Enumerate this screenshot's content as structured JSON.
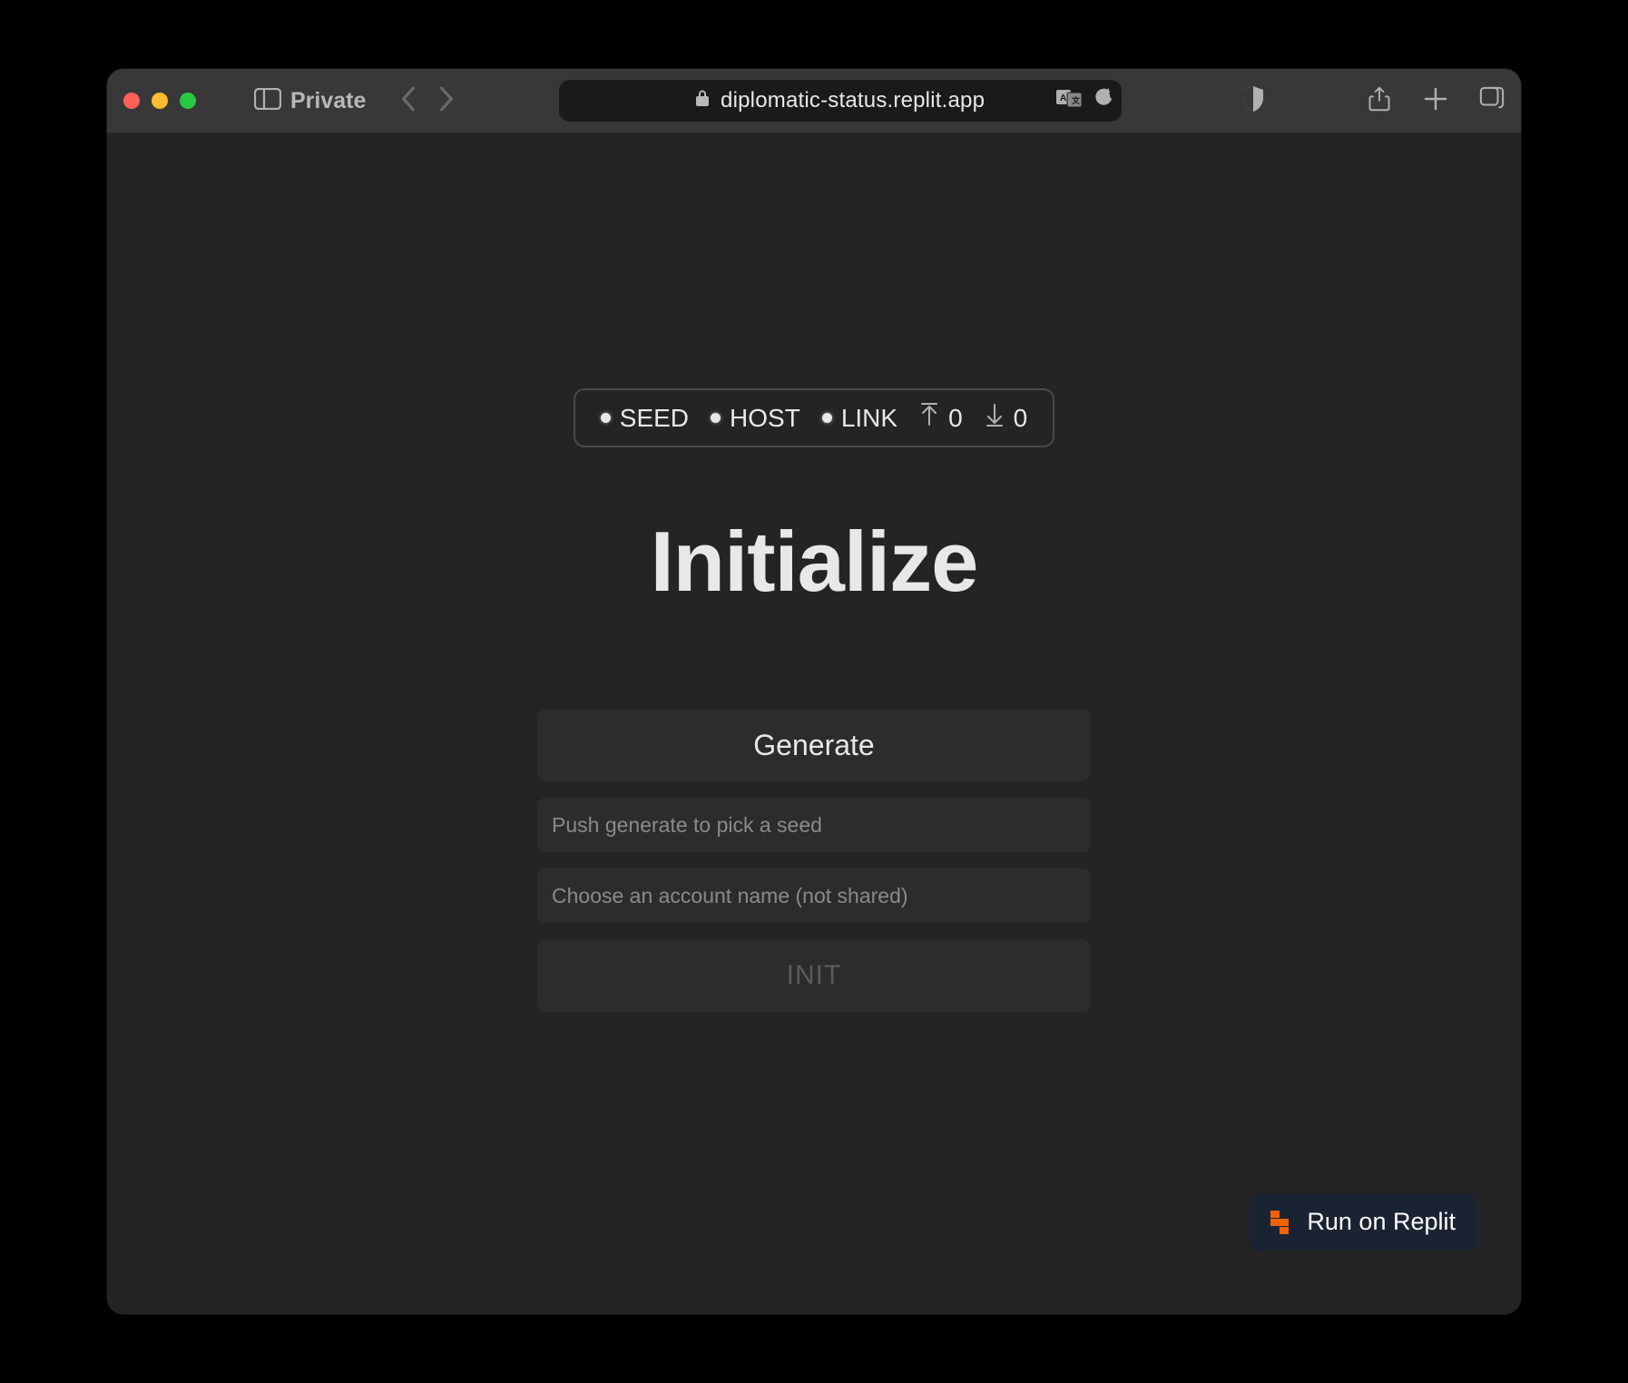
{
  "browser": {
    "private_label": "Private",
    "url": "diplomatic-status.replit.app"
  },
  "status_bar": {
    "items": [
      {
        "label": "SEED"
      },
      {
        "label": "HOST"
      },
      {
        "label": "LINK"
      }
    ],
    "upload_count": "0",
    "download_count": "0"
  },
  "page": {
    "title": "Initialize",
    "generate_button": "Generate",
    "seed_placeholder": "Push generate to pick a seed",
    "account_placeholder": "Choose an account name (not shared)",
    "init_button": "INIT"
  },
  "replit_badge": {
    "label": "Run on Replit"
  }
}
